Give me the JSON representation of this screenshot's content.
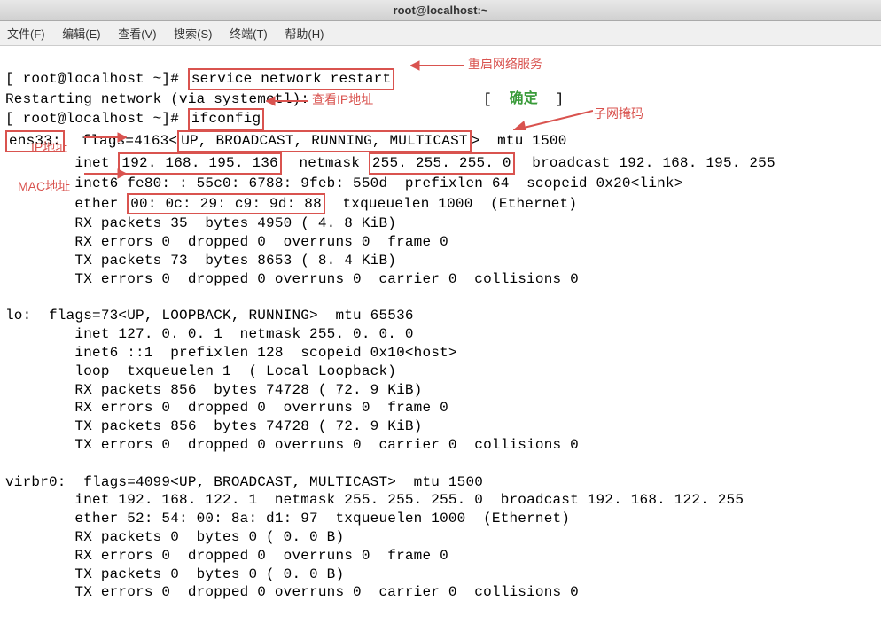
{
  "window": {
    "title": "root@localhost:~"
  },
  "menu": {
    "file": "文件(F)",
    "edit": "编辑(E)",
    "view": "查看(V)",
    "search": "搜索(S)",
    "terminal": "终端(T)",
    "help": "帮助(H)"
  },
  "annotations": {
    "restart_service": "重启网络服务",
    "check_ip": "查看IP地址",
    "subnet_mask": "子网掩码",
    "ip_address": "IP地址",
    "mac_address": "MAC地址"
  },
  "prompt": {
    "p1": "[ root@localhost ~]# ",
    "p2": "[ root@localhost ~]# "
  },
  "commands": {
    "cmd1": "service network restart",
    "cmd2": "ifconfig"
  },
  "output": {
    "restarting": "Restarting network (via systemctl):",
    "ok_left": "[  ",
    "ok": "确定",
    "ok_right": "  ]"
  },
  "ens33": {
    "name": "ens33:",
    "flags_pre": "  flags=4163<",
    "flags": "UP, BROADCAST, RUNNING, MULTICAST",
    "flags_post": ">  mtu 1500",
    "l2a": "        inet ",
    "ip": "192. 168. 195. 136",
    "l2b": "  netmask ",
    "netmask": "255. 255. 255. 0",
    "l2c": "  broadcast 192. 168. 195. 255",
    "l3": "        inet6 fe80: : 55c0: 6788: 9feb: 550d  prefixlen 64  scopeid 0x20<link>",
    "l4a": "        ether ",
    "mac": "00: 0c: 29: c9: 9d: 88",
    "l4b": "  txqueuelen 1000  (Ethernet)",
    "l5": "        RX packets 35  bytes 4950 ( 4. 8 KiB)",
    "l6": "        RX errors 0  dropped 0  overruns 0  frame 0",
    "l7": "        TX packets 73  bytes 8653 ( 8. 4 KiB)",
    "l8": "        TX errors 0  dropped 0 overruns 0  carrier 0  collisions 0"
  },
  "lo": {
    "l1": "lo:  flags=73<UP, LOOPBACK, RUNNING>  mtu 65536",
    "l2": "        inet 127. 0. 0. 1  netmask 255. 0. 0. 0",
    "l3": "        inet6 ::1  prefixlen 128  scopeid 0x10<host>",
    "l4": "        loop  txqueuelen 1  ( Local Loopback)",
    "l5": "        RX packets 856  bytes 74728 ( 72. 9 KiB)",
    "l6": "        RX errors 0  dropped 0  overruns 0  frame 0",
    "l7": "        TX packets 856  bytes 74728 ( 72. 9 KiB)",
    "l8": "        TX errors 0  dropped 0 overruns 0  carrier 0  collisions 0"
  },
  "virbr0": {
    "l1": "virbr0:  flags=4099<UP, BROADCAST, MULTICAST>  mtu 1500",
    "l2": "        inet 192. 168. 122. 1  netmask 255. 255. 255. 0  broadcast 192. 168. 122. 255",
    "l3": "        ether 52: 54: 00: 8a: d1: 97  txqueuelen 1000  (Ethernet)",
    "l4": "        RX packets 0  bytes 0 ( 0. 0 B)",
    "l5": "        RX errors 0  dropped 0  overruns 0  frame 0",
    "l6": "        TX packets 0  bytes 0 ( 0. 0 B)",
    "l7": "        TX errors 0  dropped 0 overruns 0  carrier 0  collisions 0"
  }
}
